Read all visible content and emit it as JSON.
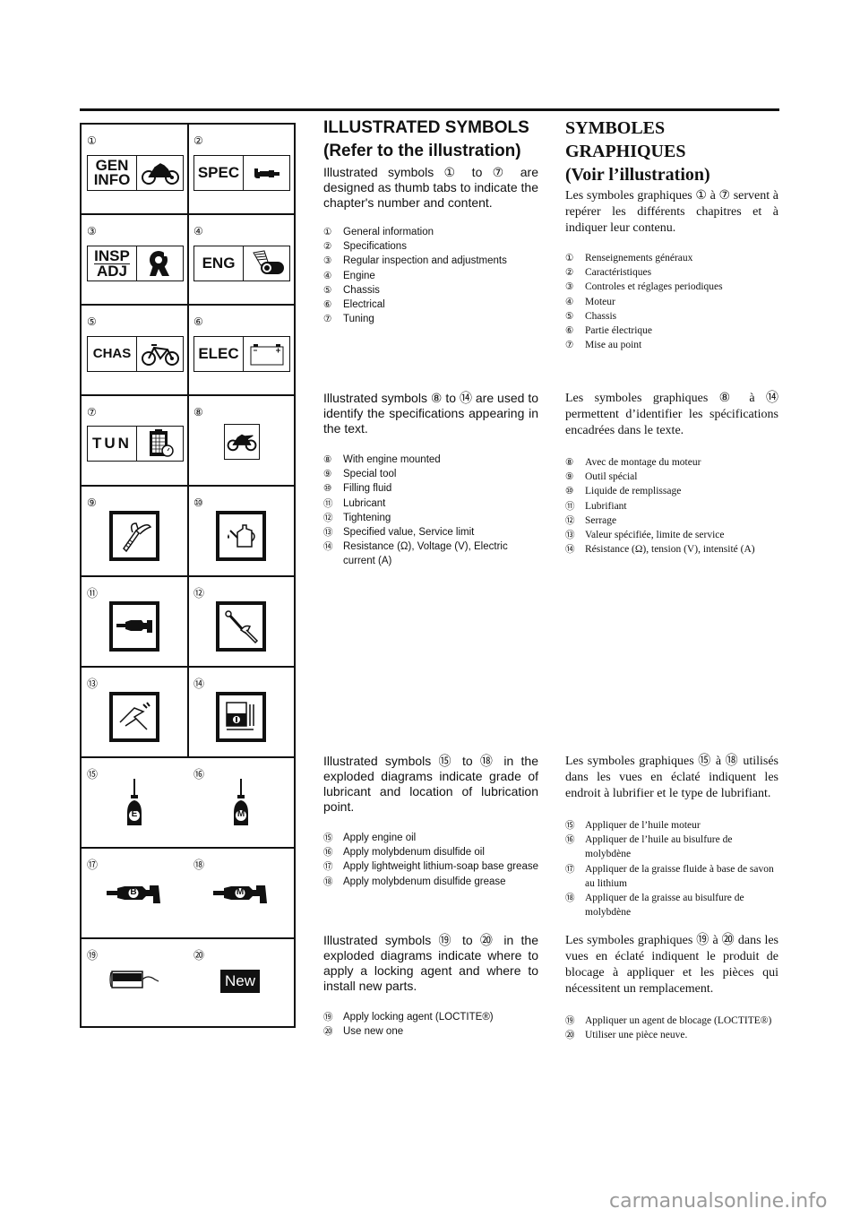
{
  "english": {
    "title_line1": "ILLUSTRATED SYMBOLS",
    "title_line2": "(Refer to the illustration)",
    "intro1": "Illustrated symbols ① to ⑦ are designed as thumb tabs to indicate the chapter's number and content.",
    "list1": [
      {
        "num": "①",
        "text": "General information"
      },
      {
        "num": "②",
        "text": "Specifications"
      },
      {
        "num": "③",
        "text": "Regular inspection and adjustments"
      },
      {
        "num": "④",
        "text": "Engine"
      },
      {
        "num": "⑤",
        "text": "Chassis"
      },
      {
        "num": "⑥",
        "text": "Electrical"
      },
      {
        "num": "⑦",
        "text": "Tuning"
      }
    ],
    "intro2": "Illustrated symbols ⑧ to ⑭ are used to identify the specifications appearing in the text.",
    "list2": [
      {
        "num": "⑧",
        "text": "With engine mounted"
      },
      {
        "num": "⑨",
        "text": "Special tool"
      },
      {
        "num": "⑩",
        "text": "Filling fluid"
      },
      {
        "num": "⑪",
        "text": "Lubricant"
      },
      {
        "num": "⑫",
        "text": "Tightening"
      },
      {
        "num": "⑬",
        "text": "Specified value, Service limit"
      },
      {
        "num": "⑭",
        "text": "Resistance (Ω), Voltage (V), Electric current (A)"
      }
    ],
    "intro3": "Illustrated symbols ⑮ to ⑱ in the exploded diagrams indicate grade of lubricant and location of lubrication point.",
    "list3": [
      {
        "num": "⑮",
        "text": "Apply engine oil"
      },
      {
        "num": "⑯",
        "text": "Apply molybdenum disulfide oil"
      },
      {
        "num": "⑰",
        "text": "Apply lightweight lithium-soap base grease"
      },
      {
        "num": "⑱",
        "text": "Apply molybdenum disulfide grease"
      }
    ],
    "intro4": "Illustrated symbols ⑲ to ⑳ in the exploded diagrams indicate where to apply a locking agent and where to install new parts.",
    "list4": [
      {
        "num": "⑲",
        "text": "Apply locking agent (LOCTITE®)"
      },
      {
        "num": "⑳",
        "text": "Use new one"
      }
    ]
  },
  "french": {
    "title_line1": "SYMBOLES",
    "title_line2": "GRAPHIQUES",
    "title_line3": "(Voir l’illustration)",
    "intro1": "Les symboles graphiques ① à ⑦ servent à repérer les différents chapitres et à indiquer leur contenu.",
    "list1": [
      {
        "num": "①",
        "text": "Renseignements généraux"
      },
      {
        "num": "②",
        "text": "Caractéristiques"
      },
      {
        "num": "③",
        "text": "Controles et réglages periodiques"
      },
      {
        "num": "④",
        "text": "Moteur"
      },
      {
        "num": "⑤",
        "text": "Chassis"
      },
      {
        "num": "⑥",
        "text": "Partie électrique"
      },
      {
        "num": "⑦",
        "text": "Mise au point"
      }
    ],
    "intro2": "Les symboles graphiques ⑧ à ⑭ permettent d’identifier les spécifications encadrées dans le texte.",
    "list2": [
      {
        "num": "⑧",
        "text": "Avec de montage du moteur"
      },
      {
        "num": "⑨",
        "text": "Outil spécial"
      },
      {
        "num": "⑩",
        "text": "Liquide de remplissage"
      },
      {
        "num": "⑪",
        "text": "Lubrifiant"
      },
      {
        "num": "⑫",
        "text": "Serrage"
      },
      {
        "num": "⑬",
        "text": "Valeur spécifiée, limite de service"
      },
      {
        "num": "⑭",
        "text": "Résistance (Ω), tension (V), intensité (A)"
      }
    ],
    "intro3": "Les symboles graphiques ⑮ à ⑱ utilisés dans les vues en éclaté indiquent les endroit à lubrifier et le type de lubrifiant.",
    "list3": [
      {
        "num": "⑮",
        "text": "Appliquer de l’huile moteur"
      },
      {
        "num": "⑯",
        "text": "Appliquer de l’huile au bisulfure de molybdène"
      },
      {
        "num": "⑰",
        "text": "Appliquer de la graisse fluide à base de savon au lithium"
      },
      {
        "num": "⑱",
        "text": "Appliquer de la graisse au bisulfure de molybdène"
      }
    ],
    "intro4": "Les symboles graphiques ⑲ à ⑳ dans les vues en éclaté indiquent le produit de blocage à appliquer et les pièces qui nécessitent un remplacement.",
    "list4": [
      {
        "num": "⑲",
        "text": "Appliquer un agent de blocage (LOCTITE®)"
      },
      {
        "num": "⑳",
        "text": "Utiliser une pièce neuve."
      }
    ]
  },
  "symbols": {
    "nums": [
      "①",
      "②",
      "③",
      "④",
      "⑤",
      "⑥",
      "⑦",
      "⑧",
      "⑨",
      "⑩",
      "⑪",
      "⑫",
      "⑬",
      "⑭",
      "⑮",
      "⑯",
      "⑰",
      "⑱",
      "⑲",
      "⑳"
    ],
    "tab_gen_1": "GEN",
    "tab_gen_2": "INFO",
    "tab_spec": "SPEC",
    "tab_insp_1": "INSP",
    "tab_insp_2": "ADJ",
    "tab_eng": "ENG",
    "tab_chas": "CHAS",
    "tab_elec": "ELEC",
    "tab_tun": "TUN",
    "grease_b": "B",
    "grease_m": "M",
    "oil_e": "E",
    "oil_m": "M",
    "new_label": "New",
    "icons": [
      "motorcycle-icon",
      "micrometer-icon",
      "wrench-nut-icon",
      "engine-piston-icon",
      "bicycle-chassis-icon",
      "battery-icon",
      "clipboard-stopwatch-icon",
      "motorcycle-icon",
      "special-tool-icon",
      "oil-can-icon",
      "grease-gun-icon",
      "torque-wrench-icon",
      "caliper-icon",
      "multimeter-icon",
      "oil-bottle-icon",
      "oil-bottle-icon",
      "grease-gun-icon",
      "grease-gun-icon",
      "locking-agent-tube-icon",
      "new-part-icon"
    ]
  },
  "watermark": "carmanualsonline.info"
}
